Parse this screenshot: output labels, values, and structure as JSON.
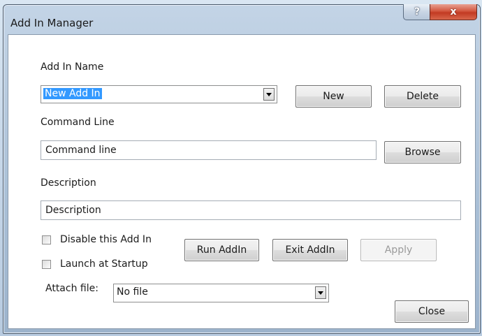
{
  "window": {
    "title": "Add In Manager",
    "help_button": "?",
    "close_button": "x"
  },
  "form": {
    "addin_name_label": "Add In Name",
    "addin_name_value": "New Add In",
    "command_line_label": "Command Line",
    "command_line_value": "Command line",
    "description_label": "Description",
    "description_value": "Description",
    "attach_file_label": "Attach file:",
    "attach_file_value": "No file"
  },
  "checkboxes": {
    "disable": {
      "label": "Disable this Add In",
      "checked": false
    },
    "startup": {
      "label": "Launch at Startup",
      "checked": false
    }
  },
  "buttons": {
    "new": "New",
    "delete": "Delete",
    "browse": "Browse",
    "run": "Run AddIn",
    "exit": "Exit AddIn",
    "apply": "Apply",
    "close": "Close"
  },
  "colors": {
    "selection": "#3399ff",
    "close_button": "#c23a22"
  }
}
